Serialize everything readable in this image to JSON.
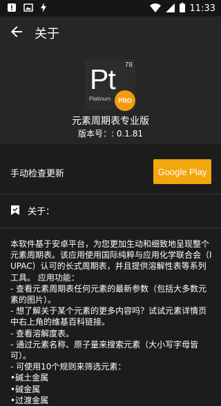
{
  "status_bar": {
    "time": "11:33",
    "left_icons": [
      "warning-icon",
      "photo-icon",
      "flash-icon"
    ],
    "right_icons": [
      "wifi-icon",
      "signal-icon",
      "battery-icon"
    ]
  },
  "app_bar": {
    "title": "关于"
  },
  "header": {
    "logo": {
      "symbol": "Pt",
      "number": "78",
      "name": "Platinum",
      "badge": "PRO"
    },
    "app_name": "元素周期表专业版",
    "version": "版本号：: 0.1.81"
  },
  "update": {
    "label": "手动检查更新",
    "button": "Google Play"
  },
  "about": {
    "label": "关于：",
    "text": "本软件基于安卓平台，为您更加生动和细致地呈现整个元素周期表。该应用使用国际纯粹与应用化学联合会（IUPAC）认可的长式周期表，并且提供溶解性表等系列工具。 应用功能：\n- 查看元素周期表任何元素的最新参数（包括大多数元素的图片）。\n- 想了解关于某个元素的更多内容吗？试试元素详情页中右上角的维基百科链接。\n- 查看溶解度表。\n- 通过元素名称、原子量来搜索元素（大小写字母皆可）。\n- 可使用10个规则来筛选元素：\n•碱土金属\n•碱金属\n•过渡金属"
  },
  "colors": {
    "background": "#1c1c1c",
    "header": "#262626",
    "accent": "#f4a60d",
    "badge": "#f39c12"
  }
}
